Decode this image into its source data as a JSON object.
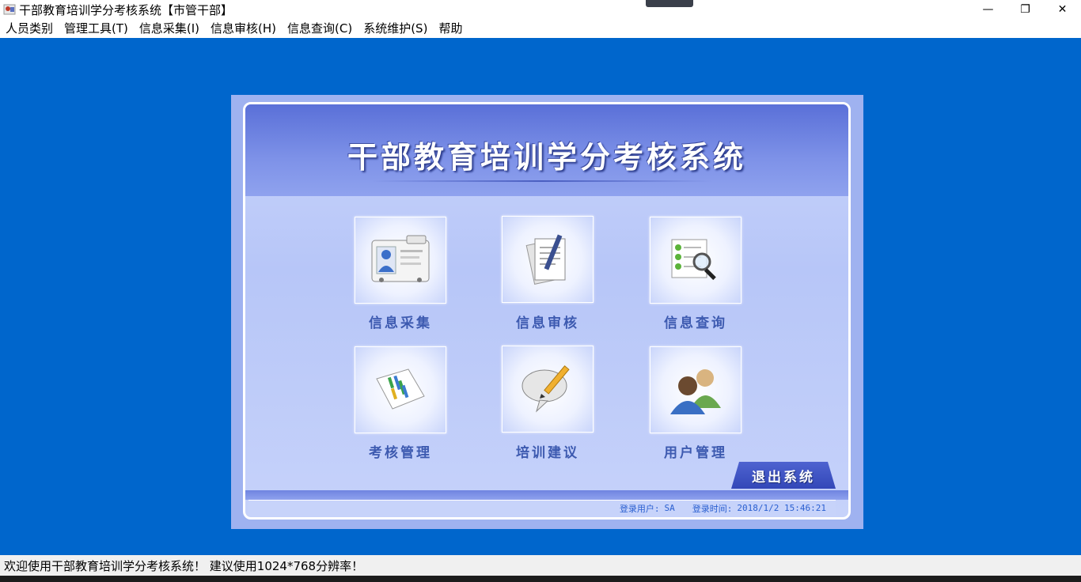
{
  "window": {
    "title": "干部教育培训学分考核系统【市管干部】",
    "minimize": "—",
    "maximize": "❐",
    "close": "✕"
  },
  "menu": [
    "人员类别",
    "管理工具(T)",
    "信息采集(I)",
    "信息审核(H)",
    "信息查询(C)",
    "系统维护(S)",
    "帮助"
  ],
  "main": {
    "header_title": "干部教育培训学分考核系统",
    "tiles": [
      {
        "label": "信息采集",
        "icon": "contact-card-icon"
      },
      {
        "label": "信息审核",
        "icon": "document-pen-icon"
      },
      {
        "label": "信息查询",
        "icon": "checklist-search-icon"
      },
      {
        "label": "考核管理",
        "icon": "gantt-chart-icon"
      },
      {
        "label": "培训建议",
        "icon": "speech-bubble-pencil-icon"
      },
      {
        "label": "用户管理",
        "icon": "users-icon"
      }
    ],
    "exit_label": "退出系统",
    "login_user_label": "登录用户:",
    "login_user": "SA",
    "login_time_label": "登录时间:",
    "login_time": "2018/1/2 15:46:21"
  },
  "status": {
    "text": "欢迎使用干部教育培训学分考核系统！  建议使用1024*768分辨率！"
  },
  "colors": {
    "desktop": "#0066cc",
    "header": "#5a70d8",
    "label": "#3d5ab0"
  }
}
